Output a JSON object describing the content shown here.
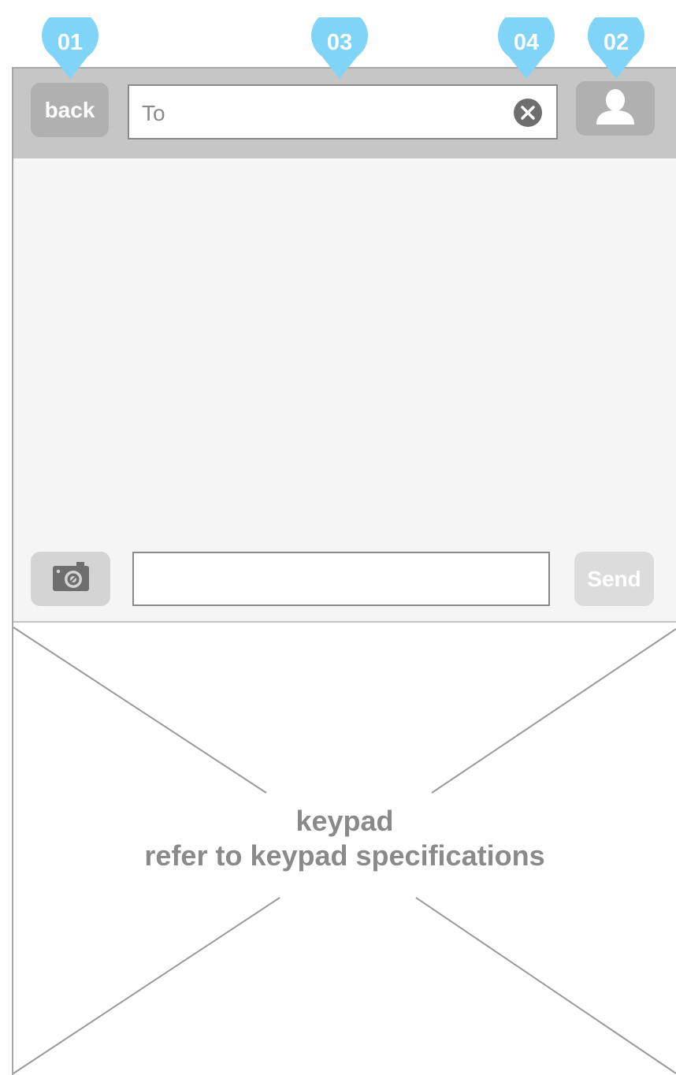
{
  "header": {
    "back_label": "back",
    "to_placeholder": "To",
    "contacts_icon": "person-icon",
    "clear_icon": "close-circle-icon"
  },
  "compose": {
    "camera_icon": "camera-icon",
    "message_value": "",
    "send_label": "Send"
  },
  "keypad": {
    "title": "keypad",
    "subtitle": "refer to keypad specifications"
  },
  "annotations": [
    {
      "label": "01"
    },
    {
      "label": "03"
    },
    {
      "label": "04"
    },
    {
      "label": "02"
    }
  ],
  "colors": {
    "annotation": "#7fd4f8",
    "header_bg": "#c6c6c6",
    "content_bg": "#f5f5f5",
    "button_grey": "#b0b0b0"
  }
}
